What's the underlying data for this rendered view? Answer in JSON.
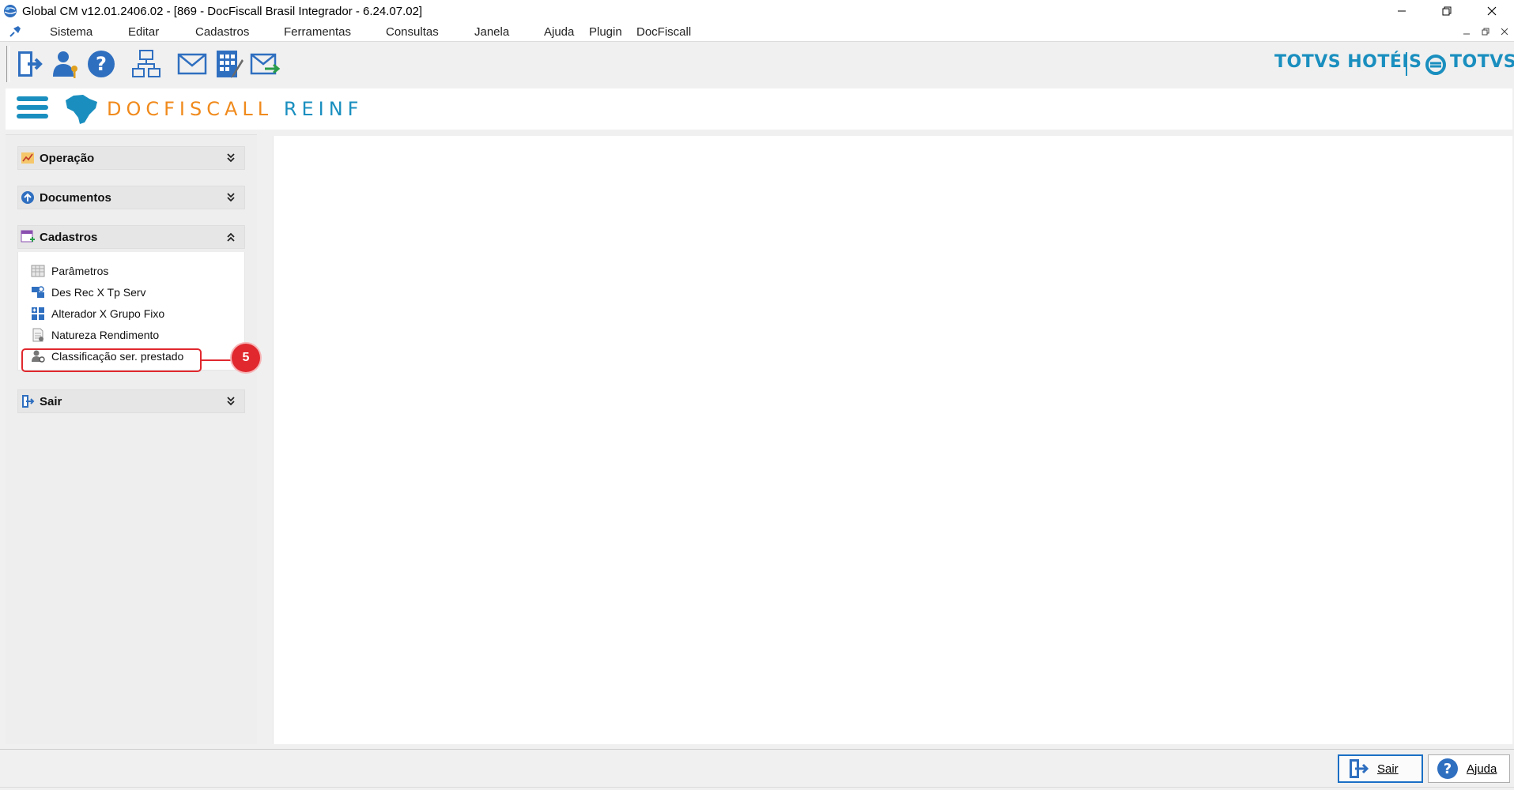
{
  "window": {
    "title": "Global CM v12.01.2406.02 - [869 - DocFiscall Brasil Integrador - 6.24.07.02]"
  },
  "menu": {
    "items": [
      "Sistema",
      "Editar",
      "Cadastros",
      "Ferramentas",
      "Consultas",
      "Janela",
      "Ajuda",
      "Plugin",
      "DocFiscall"
    ]
  },
  "toolbar": {
    "buttons": [
      {
        "icon": "exit-door-icon"
      },
      {
        "icon": "user-key-icon"
      },
      {
        "icon": "help-icon"
      },
      {
        "icon": "network-diagram-icon"
      },
      {
        "icon": "envelope-icon"
      },
      {
        "icon": "calculator-pencil-icon"
      },
      {
        "icon": "envelope-send-icon"
      }
    ],
    "brand_left": "TOTVS HOTÉIS",
    "brand_right": "TOTVS"
  },
  "header": {
    "product_part1": "DOCFISCALL",
    "product_part2": "REINF"
  },
  "sidebar": {
    "sections": [
      {
        "label": "Operação",
        "expanded": false
      },
      {
        "label": "Documentos",
        "expanded": false
      },
      {
        "label": "Cadastros",
        "expanded": true
      },
      {
        "label": "Sair",
        "expanded": false
      }
    ],
    "cadastros_items": [
      {
        "label": "Parâmetros",
        "icon": "grid-table-icon"
      },
      {
        "label": "Des Rec X Tp Serv",
        "icon": "service-link-icon"
      },
      {
        "label": "Alterador X Grupo Fixo",
        "icon": "grid-group-icon"
      },
      {
        "label": "Natureza Rendimento",
        "icon": "document-icon"
      },
      {
        "label": "Classificação ser. prestado",
        "icon": "user-gear-icon"
      }
    ],
    "callout_number": "5"
  },
  "statusbar": {
    "sair_label": "Sair",
    "ajuda_label": "Ajuda"
  },
  "colors": {
    "brand_blue": "#1a8fbf",
    "brand_orange": "#f08a1c",
    "highlight_red": "#e0282e"
  }
}
